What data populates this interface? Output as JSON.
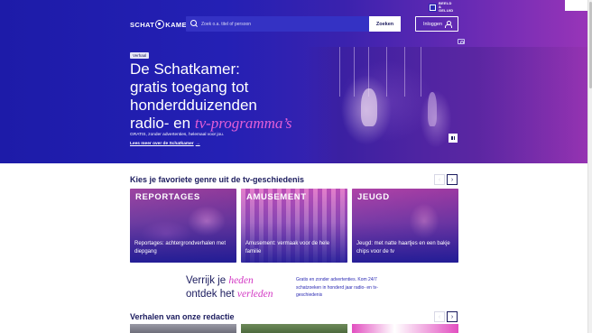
{
  "header": {
    "partner_logo": "BEELD & GELUID",
    "brand": {
      "left": "SCHAT",
      "right": "KAMER"
    },
    "search": {
      "placeholder": "Zoek o.a. titel of persoon",
      "button": "Zoeken"
    },
    "login": "Inloggen"
  },
  "hero": {
    "badge": "Verhaal",
    "title_lines": [
      "De Schatkamer:",
      "gratis toegang tot",
      "honderdduizenden",
      "radio- en"
    ],
    "title_accent": "tv-programma’s",
    "subtitle": "GRATIS, zonder advertenties, helemaal voor jou.",
    "link": "Lees meer over de Schatkamer"
  },
  "genres": {
    "title": "Kies je favoriete genre uit de tv-geschiedenis",
    "cards": [
      {
        "tag": "REPORTAGES",
        "text": "Reportages: achtergrondverhalen met diepgang"
      },
      {
        "tag": "AMUSEMENT",
        "text": "Amusement: vermaak voor de hele familie"
      },
      {
        "tag": "JEUGD",
        "text": "Jeugd: met natte haartjes en een bakje chips voor de tv"
      }
    ]
  },
  "promo": {
    "line1_prefix": "Verrijk je",
    "line1_accent": "heden",
    "line2_prefix": "ontdek het",
    "line2_accent": "verleden",
    "text": "Gratis en zonder advertenties. Kom 24/7 schatzoeken in honderd jaar radio- en tv-geschiedenis"
  },
  "stories": {
    "title": "Verhalen van onze redactie"
  },
  "icons": {
    "nav_prev": "chevron-left-icon",
    "nav_next": "chevron-right-icon",
    "search": "search-icon",
    "user": "user-icon",
    "camera": "camera-icon",
    "pause": "pause-icon"
  },
  "colors": {
    "brand_blue": "#2420b4",
    "accent_pink": "#e35fd7",
    "dark_text": "#1b1b5e"
  }
}
